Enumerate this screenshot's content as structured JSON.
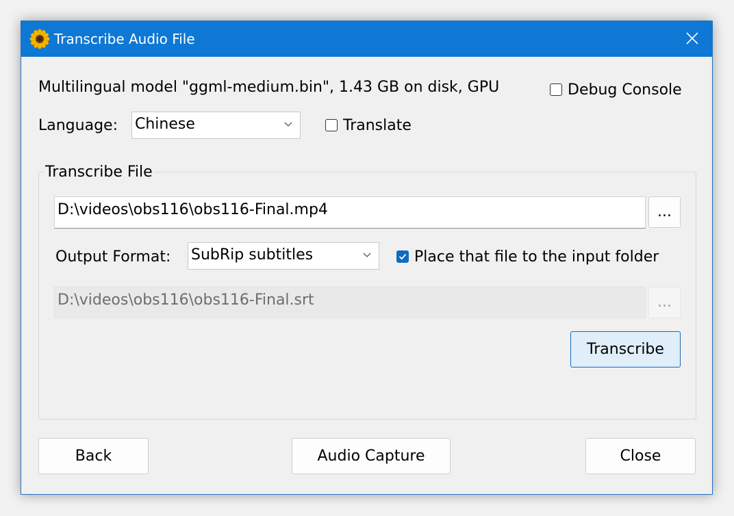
{
  "window": {
    "title": "Transcribe Audio File",
    "app_icon": "sunflower-icon",
    "close_icon": "close-icon"
  },
  "model_info": "Multilingual model \"ggml-medium.bin\", 1.43 GB on disk, GPU",
  "debug_console": {
    "label": "Debug Console",
    "checked": false
  },
  "language": {
    "label": "Language:",
    "selected": "Chinese"
  },
  "translate": {
    "label": "Translate",
    "checked": false
  },
  "transcribe_group": {
    "title": "Transcribe File",
    "input_path": "D:\\videos\\obs116\\obs116-Final.mp4",
    "browse_label": "...",
    "output_format_label": "Output Format:",
    "output_format_selected": "SubRip subtitles",
    "place_in_input_folder": {
      "label": "Place that file to the input folder",
      "checked": true
    },
    "output_path": "D:\\videos\\obs116\\obs116-Final.srt",
    "output_browse_label": "...",
    "transcribe_button": "Transcribe"
  },
  "footer": {
    "back": "Back",
    "audio_capture": "Audio Capture",
    "close": "Close"
  },
  "colors": {
    "titlebar": "#0f78d4",
    "accent": "#0f6cbd",
    "window_bg": "#f0f0f0"
  }
}
